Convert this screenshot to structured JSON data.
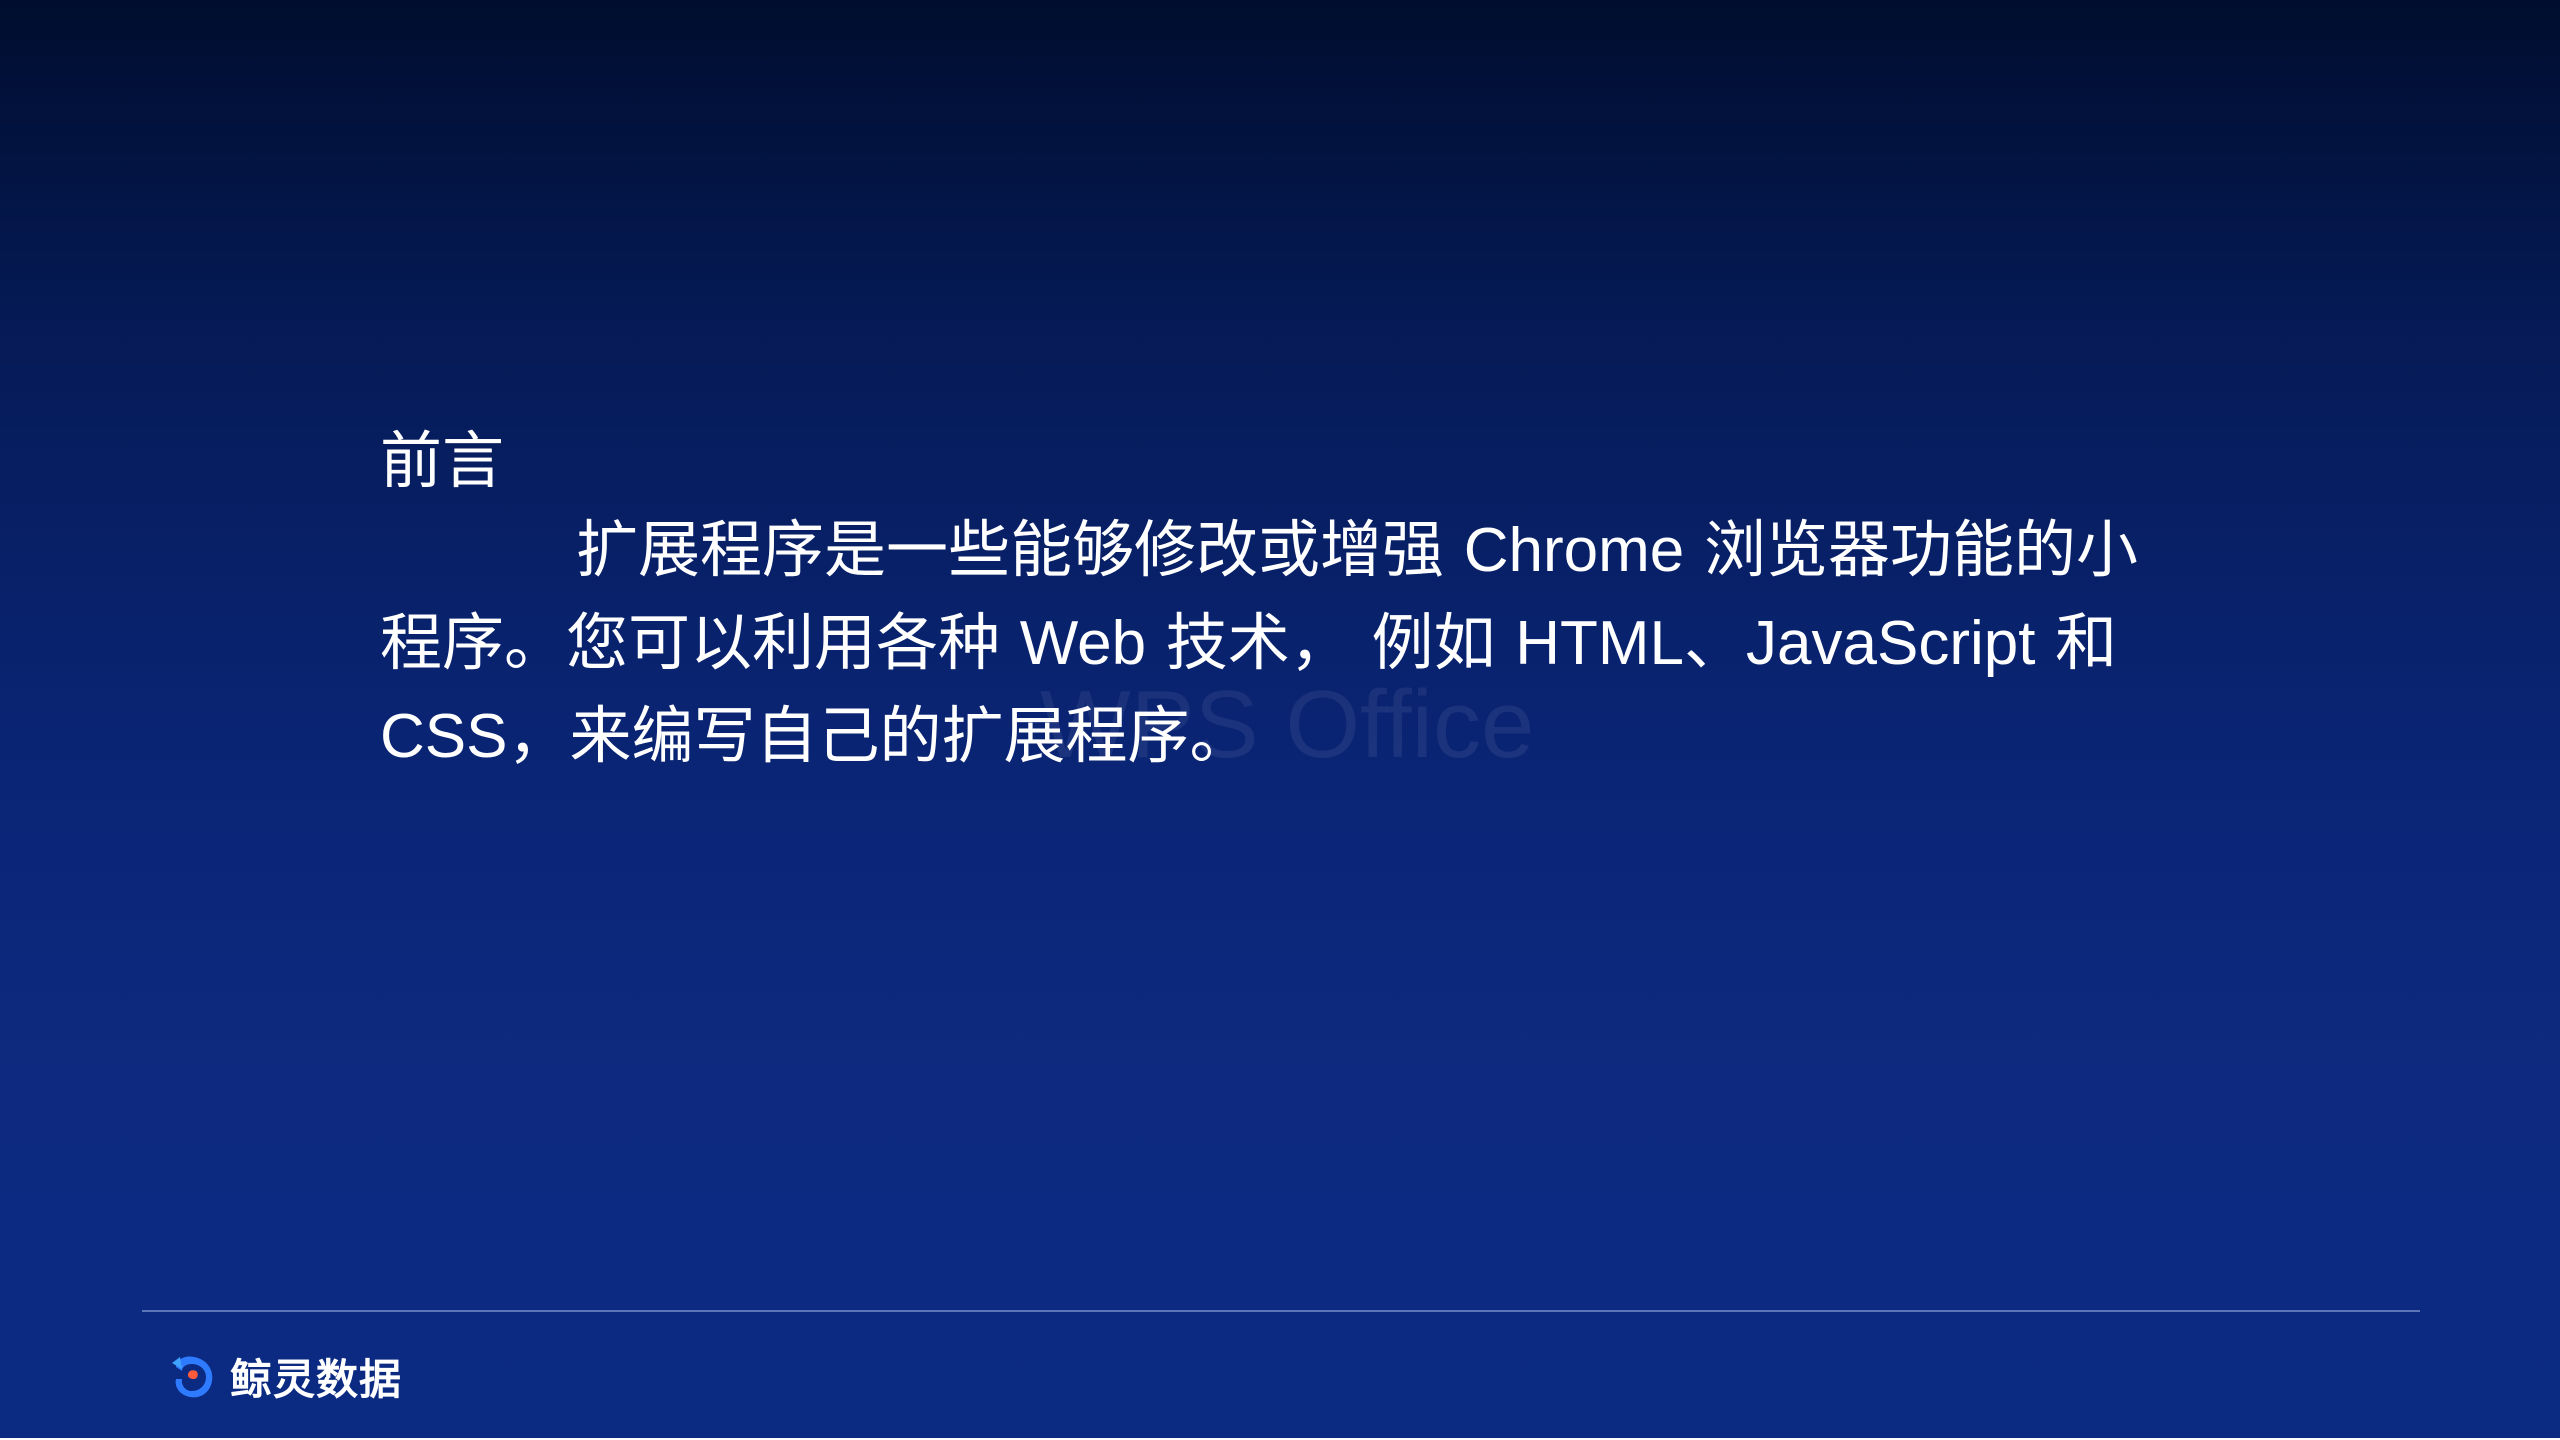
{
  "slide": {
    "watermark": "WPS Office",
    "heading": "前言",
    "paragraph": {
      "part1": "扩展程序是一些能够修改或增强 ",
      "part2": "Chrome",
      "part3": " 浏览器功能的小程序。您可以利用各种 ",
      "part4": "Web",
      "part5": " 技术， 例如 ",
      "part6": "HTML",
      "part7": "、",
      "part8": "JavaScript",
      "part9": " 和 ",
      "part10": "CSS",
      "part11": "，来编写自己的扩展程序。"
    }
  },
  "footer": {
    "brand_name": "鲸灵数据",
    "logo_icon": "whale-logo-icon"
  },
  "colors": {
    "background_top": "#000d2e",
    "background_bottom": "#0b2a82",
    "text": "#ffffff",
    "logo_blue": "#2f7bff"
  }
}
